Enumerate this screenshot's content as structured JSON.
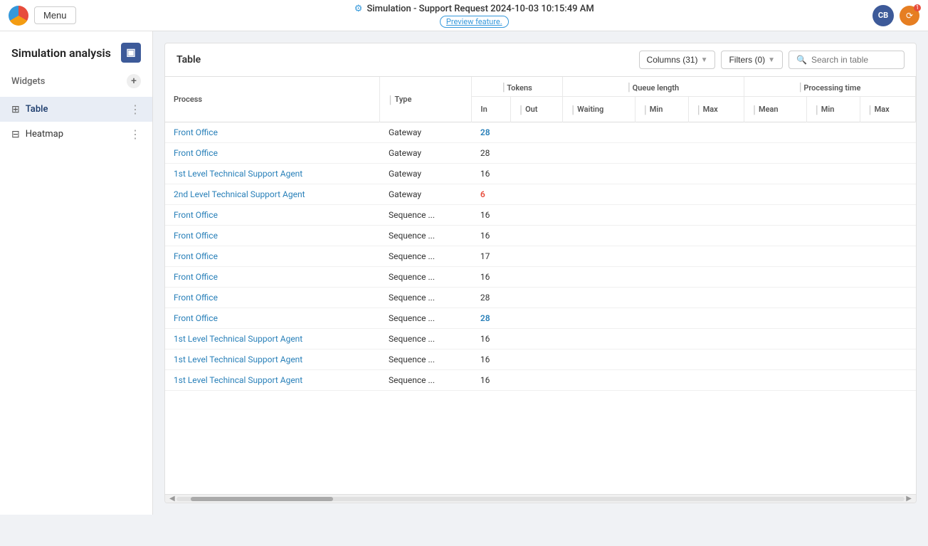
{
  "topbar": {
    "title": "Simulation - Support Request 2024-10-03 10:15:49 AM",
    "preview_label": "Preview feature.",
    "menu_label": "Menu",
    "avatar": "CB"
  },
  "sidebar": {
    "title": "Simulation analysis",
    "collapse_icon": "▣",
    "widgets_label": "Widgets",
    "add_label": "+",
    "items": [
      {
        "id": "table",
        "icon": "⊞",
        "label": "Table",
        "active": true
      },
      {
        "id": "heatmap",
        "icon": "⊟",
        "label": "Heatmap",
        "active": false
      }
    ]
  },
  "widget": {
    "title": "Table",
    "columns_label": "Columns (31)",
    "filters_label": "Filters (0)",
    "search_placeholder": "Search in table"
  },
  "table": {
    "columns": {
      "process": "Process",
      "type": "Type",
      "tokens": "Tokens",
      "tokens_in": "In",
      "tokens_out": "Out",
      "queue_length": "Queue length",
      "queue_waiting": "Waiting",
      "queue_min": "Min",
      "queue_max": "Max",
      "processing_time": "Processing time",
      "pt_mean": "Mean",
      "pt_min": "Min",
      "pt_max": "Max"
    },
    "rows": [
      {
        "process": "Front Office",
        "type": "Gateway",
        "tokens_in": "28",
        "tokens_out": "",
        "waiting": "",
        "q_min": "",
        "q_max": "",
        "pt_mean": "",
        "pt_min": "",
        "pt_max": "",
        "highlight": true,
        "num_highlight": true
      },
      {
        "process": "Front Office",
        "type": "Gateway",
        "tokens_in": "28",
        "tokens_out": "",
        "waiting": "",
        "q_min": "",
        "q_max": "",
        "pt_mean": "",
        "pt_min": "",
        "pt_max": "",
        "highlight": false,
        "num_highlight": false
      },
      {
        "process": "1st Level Technical Support Agent",
        "type": "Gateway",
        "tokens_in": "16",
        "tokens_out": "",
        "waiting": "",
        "q_min": "",
        "q_max": "",
        "pt_mean": "",
        "pt_min": "",
        "pt_max": "",
        "highlight": false,
        "num_highlight": false
      },
      {
        "process": "2nd Level Technical Support Agent",
        "type": "Gateway",
        "tokens_in": "6",
        "tokens_out": "",
        "waiting": "",
        "q_min": "",
        "q_max": "",
        "pt_mean": "",
        "pt_min": "",
        "pt_max": "",
        "highlight": true,
        "num_highlight": true
      },
      {
        "process": "Front Office",
        "type": "Sequence ...",
        "tokens_in": "16",
        "tokens_out": "",
        "waiting": "",
        "q_min": "",
        "q_max": "",
        "pt_mean": "",
        "pt_min": "",
        "pt_max": "",
        "highlight": false,
        "num_highlight": false
      },
      {
        "process": "Front Office",
        "type": "Sequence ...",
        "tokens_in": "16",
        "tokens_out": "",
        "waiting": "",
        "q_min": "",
        "q_max": "",
        "pt_mean": "",
        "pt_min": "",
        "pt_max": "",
        "highlight": false,
        "num_highlight": false
      },
      {
        "process": "Front Office",
        "type": "Sequence ...",
        "tokens_in": "17",
        "tokens_out": "",
        "waiting": "",
        "q_min": "",
        "q_max": "",
        "pt_mean": "",
        "pt_min": "",
        "pt_max": "",
        "highlight": false,
        "num_highlight": false
      },
      {
        "process": "Front Office",
        "type": "Sequence ...",
        "tokens_in": "16",
        "tokens_out": "",
        "waiting": "",
        "q_min": "",
        "q_max": "",
        "pt_mean": "",
        "pt_min": "",
        "pt_max": "",
        "highlight": false,
        "num_highlight": false
      },
      {
        "process": "Front Office",
        "type": "Sequence ...",
        "tokens_in": "28",
        "tokens_out": "",
        "waiting": "",
        "q_min": "",
        "q_max": "",
        "pt_mean": "",
        "pt_min": "",
        "pt_max": "",
        "highlight": false,
        "num_highlight": false
      },
      {
        "process": "Front Office",
        "type": "Sequence ...",
        "tokens_in": "28",
        "tokens_out": "",
        "waiting": "",
        "q_min": "",
        "q_max": "",
        "pt_mean": "",
        "pt_min": "",
        "pt_max": "",
        "highlight": false,
        "num_highlight": true
      },
      {
        "process": "1st Level Technical Support Agent",
        "type": "Sequence ...",
        "tokens_in": "16",
        "tokens_out": "",
        "waiting": "",
        "q_min": "",
        "q_max": "",
        "pt_mean": "",
        "pt_min": "",
        "pt_max": "",
        "highlight": false,
        "num_highlight": false
      },
      {
        "process": "1st Level Technical Support Agent",
        "type": "Sequence ...",
        "tokens_in": "16",
        "tokens_out": "",
        "waiting": "",
        "q_min": "",
        "q_max": "",
        "pt_mean": "",
        "pt_min": "",
        "pt_max": "",
        "highlight": false,
        "num_highlight": false
      },
      {
        "process": "1st Level Techincal Support Agent",
        "type": "Sequence ...",
        "tokens_in": "16",
        "tokens_out": "",
        "waiting": "",
        "q_min": "",
        "q_max": "",
        "pt_mean": "",
        "pt_min": "",
        "pt_max": "",
        "highlight": false,
        "num_highlight": false
      }
    ]
  }
}
